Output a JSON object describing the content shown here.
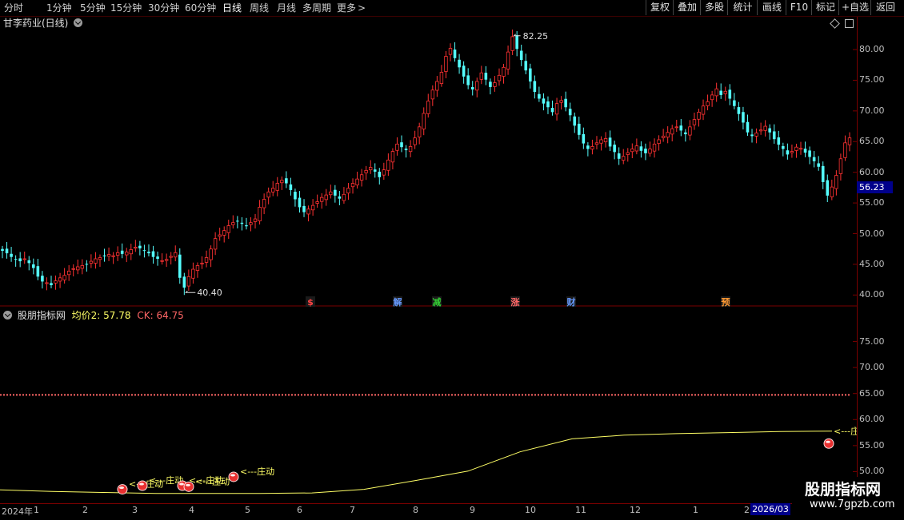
{
  "toolbar": {
    "periods": [
      "分时",
      "1分钟",
      "5分钟",
      "15分钟",
      "30分钟",
      "60分钟",
      "日线",
      "周线",
      "月线",
      "多周期",
      "更多"
    ],
    "more_arrow": ">",
    "buttons": [
      "复权",
      "叠加",
      "多股",
      "统计",
      "画线",
      "F10",
      "标记",
      "+自选",
      "返回"
    ]
  },
  "main_title": "甘李药业(日线)",
  "sub_title": "股朋指标网",
  "indicator": {
    "avg_label": "均价2: 57.78",
    "ck_label": "CK: 64.75"
  },
  "price_axis": [
    "80.00",
    "75.00",
    "70.00",
    "65.00",
    "60.00",
    "55.00",
    "50.00",
    "45.00",
    "40.00"
  ],
  "ind_axis": [
    "75.00",
    "70.00",
    "65.00",
    "60.00",
    "55.00",
    "50.00"
  ],
  "current_price": "56.23",
  "annotations": {
    "high": "82.25",
    "low": "40.40"
  },
  "events": [
    "$",
    "解",
    "减",
    "涨",
    "财",
    "预"
  ],
  "zhuang_label": "<---庄动",
  "zhuang_end": "<---庄",
  "dates": [
    "2024年",
    "1",
    "2",
    "3",
    "4",
    "5",
    "6",
    "7",
    "8",
    "9",
    "10",
    "11",
    "12",
    "1",
    "2"
  ],
  "date_end": "2026/03",
  "watermark": {
    "name": "股朋指标网",
    "url": "www.7gpzb.com"
  },
  "colors": {
    "up": "#ff3232",
    "down": "#54fcfc",
    "avg_line": "#ffff66",
    "ck_line": "#ff6666",
    "bg": "#000000"
  },
  "chart_data": {
    "type": "candlestick",
    "price_range": [
      39,
      83
    ],
    "indicator_range": [
      45,
      80
    ],
    "closes": [
      47.2,
      46.8,
      46.2,
      45.8,
      45.5,
      45.9,
      45.2,
      44.4,
      43.0,
      42.2,
      42.0,
      41.6,
      42.3,
      42.8,
      43.2,
      43.9,
      44.3,
      44.6,
      44.8,
      45.0,
      45.5,
      45.9,
      46.1,
      46.3,
      46.6,
      46.4,
      46.9,
      46.7,
      47.0,
      47.4,
      47.8,
      47.6,
      47.2,
      46.8,
      46.2,
      45.9,
      45.6,
      45.8,
      46.3,
      46.9,
      42.8,
      41.2,
      43.0,
      44.2,
      44.8,
      45.2,
      46.1,
      47.5,
      49.2,
      49.8,
      50.5,
      51.3,
      51.8,
      52.0,
      51.6,
      51.2,
      51.8,
      52.4,
      54.3,
      55.6,
      56.8,
      57.4,
      58.2,
      58.7,
      58.2,
      57.1,
      55.6,
      54.3,
      53.5,
      54.0,
      54.6,
      55.2,
      55.9,
      56.3,
      56.8,
      56.2,
      55.7,
      56.4,
      57.4,
      58.2,
      58.9,
      59.6,
      60.3,
      60.8,
      60.1,
      59.2,
      60.4,
      62.0,
      63.4,
      64.6,
      64.1,
      63.6,
      64.2,
      65.6,
      67.4,
      69.6,
      71.6,
      73.4,
      74.8,
      76.3,
      78.9,
      80.2,
      78.6,
      77.1,
      75.6,
      74.2,
      73.5,
      74.8,
      76.2,
      75.1,
      73.9,
      74.6,
      75.8,
      77.1,
      79.6,
      82.1,
      80.1,
      78.3,
      76.6,
      74.8,
      73.1,
      72.0,
      71.2,
      70.6,
      69.8,
      71.2,
      71.7,
      70.6,
      69.3,
      67.6,
      66.1,
      64.7,
      63.8,
      64.2,
      64.8,
      65.3,
      65.5,
      64.2,
      63.3,
      62.2,
      62.6,
      63.2,
      63.8,
      64.3,
      63.5,
      63.1,
      63.8,
      64.6,
      65.3,
      65.9,
      66.5,
      67.1,
      67.4,
      66.8,
      66.2,
      67.4,
      68.6,
      69.8,
      70.8,
      71.5,
      72.6,
      73.6,
      72.6,
      73.2,
      72.0,
      70.8,
      69.5,
      68.1,
      66.5,
      65.9,
      66.4,
      66.9,
      67.5,
      66.5,
      65.4,
      64.5,
      63.8,
      62.9,
      63.4,
      64.1,
      63.9,
      63.2,
      62.5,
      61.8,
      60.9,
      58.4,
      56.2,
      57.6,
      59.5,
      62.2,
      64.8,
      65.6
    ],
    "avg2": [
      46.5,
      46.2,
      46.0,
      45.8,
      45.8,
      45.8,
      45.9,
      46.6,
      48.3,
      50.1,
      53.8,
      56.3,
      57.0,
      57.3,
      57.5,
      57.7,
      57.78
    ],
    "ck": 64.75,
    "high_label": 82.25,
    "low_label": 40.4,
    "last_close": 56.23
  }
}
